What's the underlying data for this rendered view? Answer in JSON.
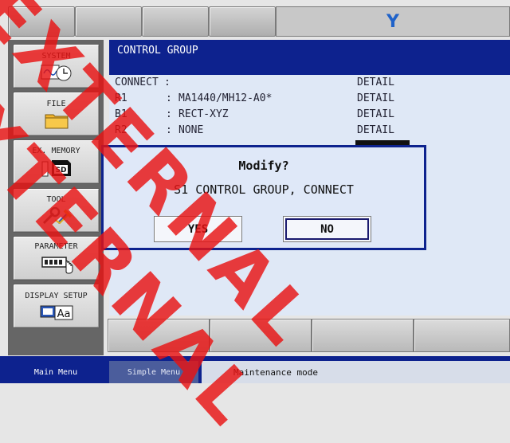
{
  "logo": "Y",
  "sidebar": {
    "items": [
      {
        "label": "SYSTEM",
        "icon": "system-icon"
      },
      {
        "label": "FILE",
        "icon": "folder-icon"
      },
      {
        "label": "EX. MEMORY",
        "icon": "sd-card-icon"
      },
      {
        "label": "TOOL",
        "icon": "tool-icon"
      },
      {
        "label": "PARAMETER",
        "icon": "parameter-icon"
      },
      {
        "label": "DISPLAY SETUP",
        "icon": "display-setup-icon"
      }
    ]
  },
  "main": {
    "title": "CONTROL GROUP",
    "rows": [
      {
        "label": "CONNECT",
        "sep": ":",
        "value": "",
        "detail": "DETAIL"
      },
      {
        "label": "R1",
        "sep": ":",
        "value": "MA1440/MH12-A0*",
        "detail": "DETAIL"
      },
      {
        "label": "B1",
        "sep": ":",
        "value": "RECT-XYZ",
        "detail": "DETAIL"
      },
      {
        "label": "R2",
        "sep": ":",
        "value": "NONE",
        "detail": "DETAIL"
      }
    ]
  },
  "dialog": {
    "title": "Modify?",
    "message": "S1 CONTROL GROUP, CONNECT",
    "yes": "YES",
    "no": "NO"
  },
  "status": {
    "main_menu": "Main Menu",
    "simple_menu": "Simple Menu",
    "message": "Maintenance mode"
  },
  "watermark": "EXTERNAL",
  "colors": {
    "title_bar": "#0d228e",
    "panel": "#dfe8f6",
    "logo": "#1f62c9",
    "watermark": "#e81212"
  }
}
